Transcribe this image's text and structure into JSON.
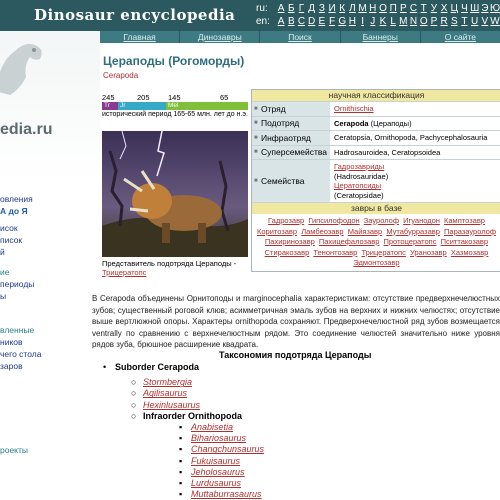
{
  "header": {
    "logo_text": "Dinosaur encyclopedia",
    "lang_rows": [
      {
        "code": "ru:",
        "letters": [
          "А",
          "Б",
          "Г",
          "Д",
          "З",
          "И",
          "К",
          "Л",
          "М",
          "Н",
          "О",
          "П",
          "Р",
          "С",
          "Т",
          "У",
          "Х",
          "Ц",
          "Ч",
          "Ш",
          "Э",
          "Ю"
        ]
      },
      {
        "code": "en:",
        "letters": [
          "A",
          "B",
          "C",
          "D",
          "E",
          "F",
          "G",
          "H",
          "I",
          "J",
          "K",
          "L",
          "M",
          "N",
          "O",
          "P",
          "R",
          "S",
          "T",
          "U",
          "V",
          "W"
        ]
      }
    ],
    "nav": [
      "Главная",
      "Динозавры",
      "Поиск",
      "Баннеры",
      "О сайте"
    ]
  },
  "sidebar": {
    "site_fragment": "edia.ru",
    "links": [
      "овления",
      "А до Я",
      "исок",
      "писок",
      "й",
      "ие",
      "периоды",
      "ы",
      "вленные",
      "ников",
      "чего стола",
      "заров",
      "роекты"
    ]
  },
  "page": {
    "title": "Цераподы (Рогоморды)",
    "subtitle": "Cerapoda"
  },
  "timeline": {
    "labels": [
      "245",
      "205",
      "145",
      "65"
    ],
    "segments": [
      {
        "name": "Tr",
        "color": "#8a3a8f"
      },
      {
        "name": "Jr",
        "color": "#36a8c8"
      },
      {
        "name": "Mel",
        "color": "#7fbf3a"
      }
    ],
    "period_text": "исторический период 165-65 млн. лет до н.э."
  },
  "caption": {
    "text": "Представитель подотряда Цераподы -",
    "link": "Трицератопс"
  },
  "classification": {
    "heading": "научная классификация",
    "rows": [
      {
        "label": "Отряд",
        "value": "Ornithischia",
        "link": true
      },
      {
        "label": "Подотряд",
        "value_bold": "Cerapoda",
        "value": " (Цераподы)",
        "link": false
      },
      {
        "label": "Инфраотряд",
        "value": "Ceratopsia, Ornithopoda, Pachycephalosauria",
        "link": false
      },
      {
        "label": "Суперсемейства",
        "value": "Hadrosauroidea, Ceratopsoidea",
        "link": false
      }
    ],
    "family_label": "Семейства",
    "families": [
      {
        "name": "Гадрозавриды",
        "latin": "(Hadrosauridae)"
      },
      {
        "name": "Цератопсиды",
        "latin": "(Ceratopsidae)"
      }
    ],
    "base_heading": "завры в базе",
    "dinos": [
      "Гадрозавр",
      "Гипсилофодон",
      "Зауролоф",
      "Игуанодон",
      "Камптозавр",
      "Коритозавр",
      "Ламбеозавр",
      "Майязавр",
      "Мутабурразавр",
      "Паразауролоф",
      "Пахиринозавр",
      "Пахицефалозавр",
      "Протоцератопс",
      "Пситтакозавр",
      "Стиракозавр",
      "Тенонтозавр",
      "Трицератопс",
      "Уранозавр",
      "Хазмозавр",
      "Эдмонтозавр"
    ]
  },
  "description": "В Cerapoda объединены Орнитоподы и marginocephalia характеристикам: отсутствие предверхнечелюстных зубов; существенный роговой клюв; асимметричная эмаль зубов на верхних и нижних челюстях; отсутствие выше вертлюжной опоры. Характеры ornithopoda сохраняют. Предверхнечелюстной ряд зубов возмещается ventrally по сравнению с верхнечелюстным рядом. Это соединение челюстей значительно ниже уровня рядов зуба, брюшное расширение квадрата.",
  "taxonomy": {
    "title": "Таксономия подотряда Цераподы",
    "suborder": "Suborder Cerapoda",
    "genera1": [
      "Stormbergia",
      "Agilisaurus",
      "Hexinlusaurus"
    ],
    "infraorder": "Infraorder Ornithopoda",
    "genera2": [
      "Anabisetia",
      "Bihariosaurus",
      "Changchunsaurus",
      "Fukuisaurus",
      "Jeholosaurus",
      "Lurdusaurus",
      "Muttaburrasaurus"
    ]
  }
}
